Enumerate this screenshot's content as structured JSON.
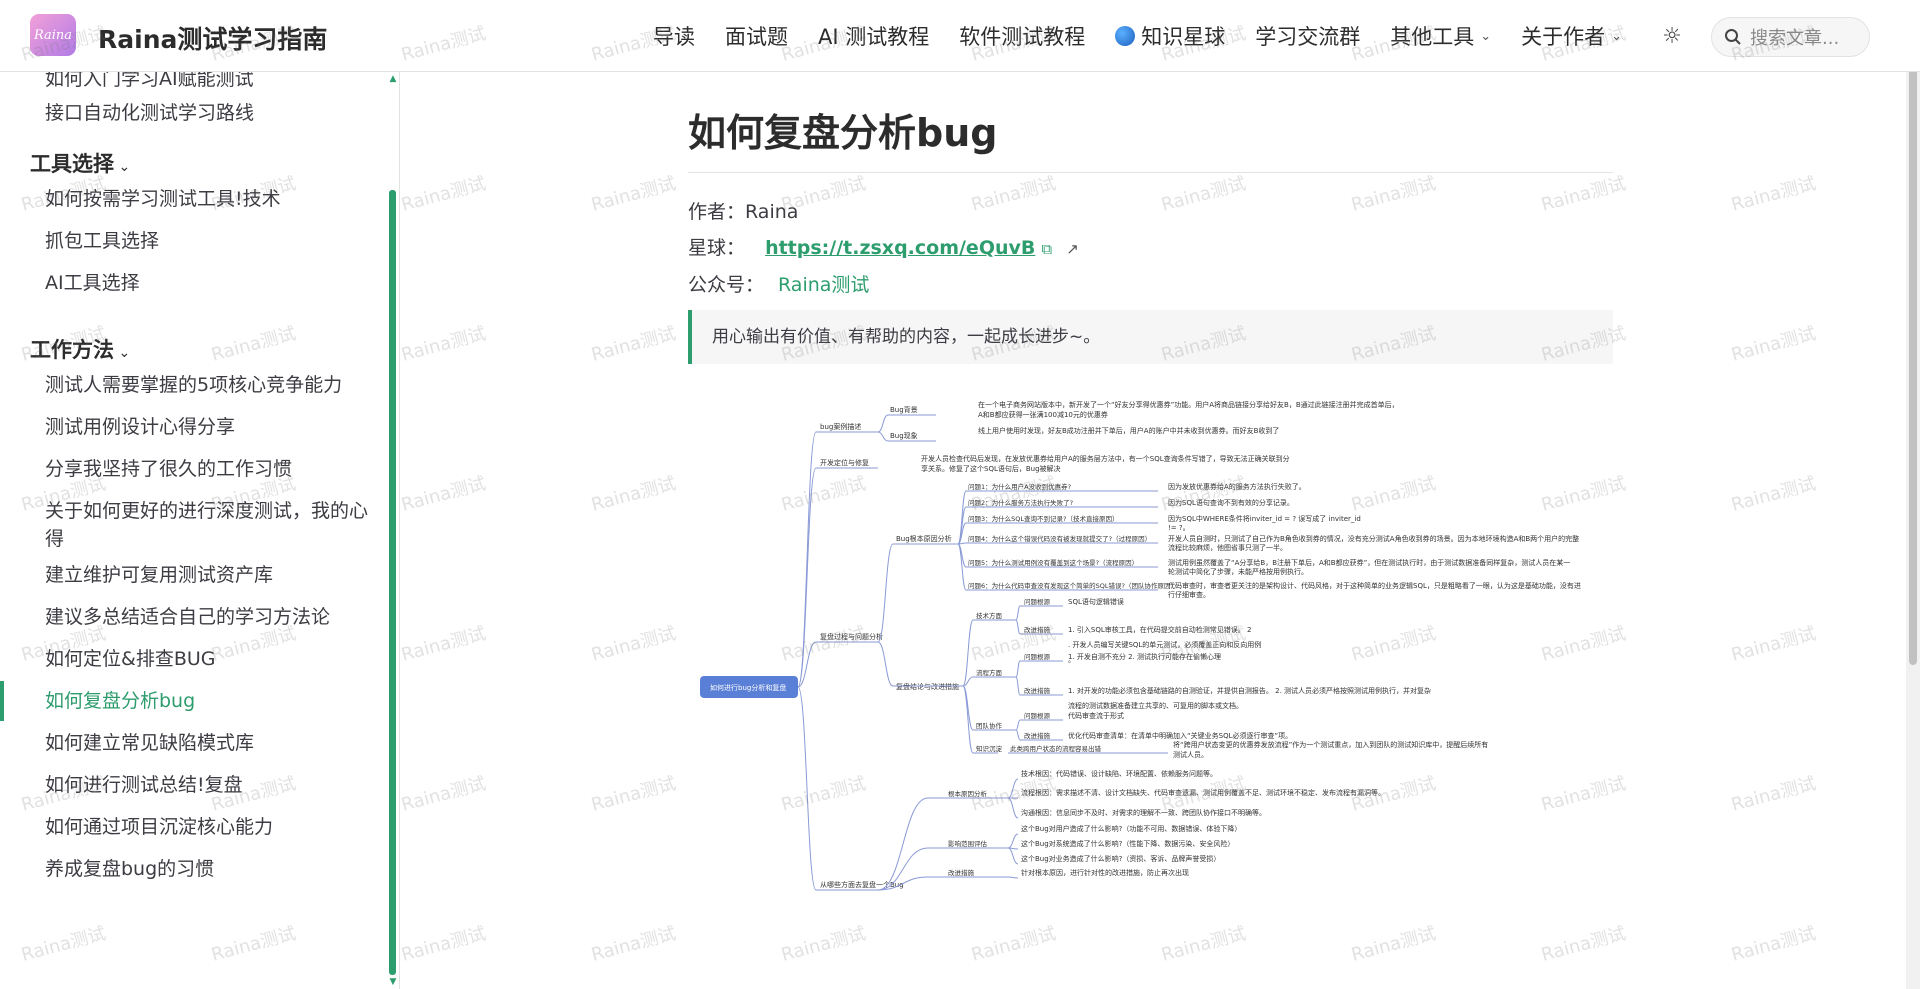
{
  "header": {
    "logo_text": "Raina",
    "site_title": "Raina测试学习指南",
    "nav": [
      {
        "label": "导读",
        "dropdown": false,
        "icon": ""
      },
      {
        "label": "面试题",
        "dropdown": false,
        "icon": ""
      },
      {
        "label": "AI 测试教程",
        "dropdown": false,
        "icon": ""
      },
      {
        "label": "软件测试教程",
        "dropdown": false,
        "icon": ""
      },
      {
        "label": "知识星球",
        "dropdown": false,
        "icon": "globe-icon"
      },
      {
        "label": "学习交流群",
        "dropdown": false,
        "icon": ""
      },
      {
        "label": "其他工具",
        "dropdown": true,
        "icon": ""
      },
      {
        "label": "关于作者",
        "dropdown": true,
        "icon": ""
      }
    ],
    "search_placeholder": "搜索文章..."
  },
  "sidebar": {
    "items_top": [
      "如何入门学习AI赋能测试",
      "接口自动化测试学习路线"
    ],
    "groups": [
      {
        "title": "工具选择",
        "items": [
          "如何按需学习测试工具!技术",
          "抓包工具选择",
          "AI工具选择"
        ]
      },
      {
        "title": "工作方法",
        "items": [
          "测试人需要掌握的5项核心竞争能力",
          "测试用例设计心得分享",
          "分享我坚持了很久的工作习惯",
          "关于如何更好的进行深度测试，我的心得",
          "建立维护可复用测试资产库",
          "建议多总结适合自己的学习方法论",
          "如何定位&排查BUG",
          "如何复盘分析bug",
          "如何建立常见缺陷模式库",
          "如何进行测试总结!复盘",
          "如何通过项目沉淀核心能力",
          "养成复盘bug的习惯"
        ]
      }
    ],
    "active_item": "如何复盘分析bug"
  },
  "article": {
    "title": "如何复盘分析bug",
    "author_label": "作者：",
    "author": "Raina",
    "planet_label": "星球：",
    "planet_link": "https://t.zsxq.com/eQuvB",
    "account_label": "公众号：",
    "account": "Raina测试",
    "quote": "用心输出有价值、有帮助的内容，一起成长进步~。"
  },
  "mindmap": {
    "root": "如何进行bug分析和复盘",
    "nodes": [
      {
        "label": "bug案例描述",
        "children": [
          {
            "label": "Bug背景",
            "text": "在一个电子商务网站版本中，新开发了一个“好友分享得优惠券”功能。用户A将商品链接分享给好友B，B通过此链接注册并完成首单后，A和B都应获得一张满100减10元的优惠券"
          },
          {
            "label": "Bug现象",
            "text": "线上用户使用时发现，好友B成功注册并下单后，用户A的账户中并未收到优惠券。而好友B收到了"
          }
        ]
      },
      {
        "label": "开发定位与修复",
        "text": "开发人员检查代码后发现，在发放优惠券给用户A的服务层方法中，有一个SQL查询条件写错了，导致无法正确关联到分享关系。修复了这个SQL语句后，Bug被解决"
      },
      {
        "label": "复盘过程与问题分析",
        "children": [
          {
            "label": "Bug根本原因分析",
            "children": [
              {
                "label": "问题1：为什么用户A没收到优惠券?",
                "text": "因为发放优惠券给A的服务方法执行失败了。"
              },
              {
                "label": "问题2：为什么服务方法执行失败了?",
                "text": "因为SQL语句查询不到有效的分享记录。"
              },
              {
                "label": "问题3：为什么SQL查询不到记录?（技术直接原因）",
                "text": "因为SQL中WHERE条件将inviter_id = ? 误写成了 inviter_id != ?。"
              },
              {
                "label": "问题4：为什么这个错误代码没有被发现就提交了?（过程原因）",
                "text": "开发人员自测时，只测试了自己作为B角色收到券的情况，没有充分测试A角色收到券的场景。因为本地环境构造A和B两个用户的完整流程比较麻烦，他图省事只测了一半。"
              },
              {
                "label": "问题5：为什么测试用例没有覆盖到这个场景?（流程原因）",
                "text": "测试用例虽然覆盖了“A分享给B，B注册下单后，A和B都应获券”，但在测试执行时，由于测试数据准备同样复杂，测试人员在某一轮测试中简化了步骤，未能严格按用例执行。"
              },
              {
                "label": "问题6：为什么代码审查没有发现这个简单的SQL错误?（团队协作原因）",
                "text": "代码审查时，审查者更关注的是架构设计、代码风格，对于这种简单的业务逻辑SQL，只是粗略看了一眼，认为这是基础功能，没有进行仔细审查。"
              }
            ]
          },
          {
            "label": "复盘结论与改进措施",
            "children": [
              {
                "label": "技术方面",
                "children": [
                  {
                    "label": "问题根源",
                    "text": "SQL语句逻辑错误"
                  },
                  {
                    "label": "改进措施",
                    "text": "1. 引入SQL审核工具，在代码提交前自动检测常见错误。 2. 开发人员编写关键SQL的单元测试，必须覆盖正向和反向用例。"
                  }
                ]
              },
              {
                "label": "流程方面",
                "children": [
                  {
                    "label": "问题根源",
                    "text": "1. 开发自测不充分 2. 测试执行可能存在偷懒心理"
                  },
                  {
                    "label": "改进措施",
                    "text": "1. 对开发的功能必须包含基础链路的自测验证，并提供自测报告。 2. 测试人员必须严格按照测试用例执行，并对复杂流程的测试数据准备建立共享的、可复用的脚本或文档。"
                  }
                ]
              },
              {
                "label": "团队协作",
                "children": [
                  {
                    "label": "问题根源",
                    "text": "代码审查流于形式"
                  },
                  {
                    "label": "改进措施",
                    "text": "优化代码审查清单：在清单中明确加入“关键业务SQL必须逐行审查”项。"
                  }
                ]
              },
              {
                "label": "知识沉淀",
                "text": "此类跨用户状态的流程容易出错",
                "extra": "将“跨用户状态变更的优惠券发放流程”作为一个测试重点，加入到团队的测试知识库中，提醒后续所有测试人员。"
              }
            ]
          }
        ]
      },
      {
        "label": "从哪些方面去复盘一个Bug",
        "children": [
          {
            "label": "根本原因分析",
            "items": [
              "技术根因：代码错误、设计缺陷、环境配置、依赖服务问题等。",
              "流程根因：需求描述不清、设计文档缺失、代码审查遗漏、测试用例覆盖不足、测试环境不稳定、发布流程有漏洞等。",
              "沟通根因：信息同步不及时、对需求的理解不一致、跨团队协作接口不明确等。"
            ]
          },
          {
            "label": "影响范围评估",
            "items": [
              "这个Bug对用户造成了什么影响?（功能不可用、数据错误、体验下降）",
              "这个Bug对系统造成了什么影响?（性能下降、数据污染、安全风险）",
              "这个Bug对业务造成了什么影响?（资损、客诉、品牌声誉受损）"
            ]
          },
          {
            "label": "改进措施",
            "items": [
              "针对根本原因，进行针对性的改进措施，防止再次出现"
            ]
          }
        ]
      }
    ]
  },
  "watermark_text": "Raina测试"
}
